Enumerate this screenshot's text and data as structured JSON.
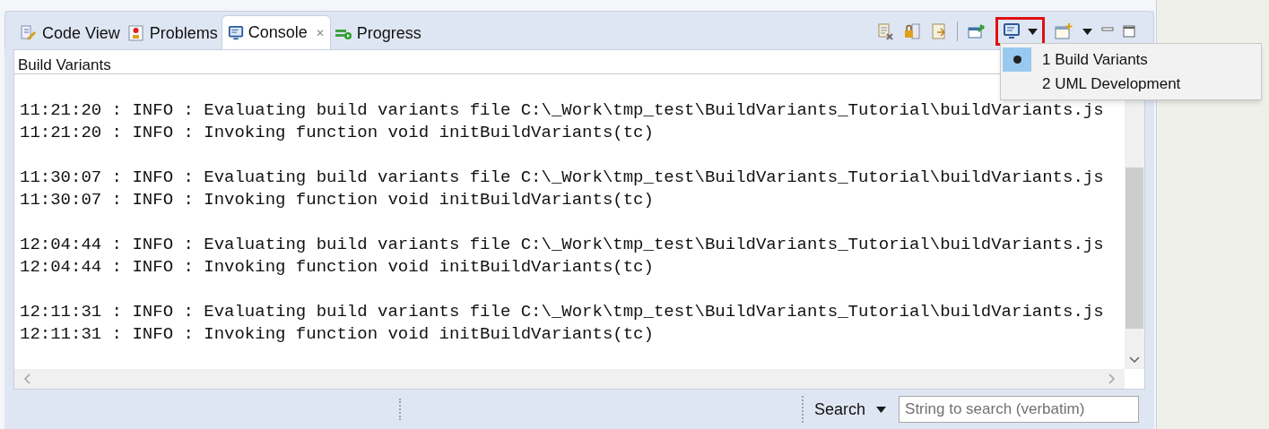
{
  "tabs": [
    {
      "label": "Code View",
      "selected": false
    },
    {
      "label": "Problems",
      "selected": false
    },
    {
      "label": "Console",
      "selected": true
    },
    {
      "label": "Progress",
      "selected": false
    }
  ],
  "close_glyph": "✕",
  "console": {
    "title": "Build Variants",
    "groups": [
      [
        "11:21:20 : INFO : Evaluating build variants file C:\\_Work\\tmp_test\\BuildVariants_Tutorial\\buildVariants.js",
        "11:21:20 : INFO : Invoking function void initBuildVariants(tc)"
      ],
      [
        "11:30:07 : INFO : Evaluating build variants file C:\\_Work\\tmp_test\\BuildVariants_Tutorial\\buildVariants.js",
        "11:30:07 : INFO : Invoking function void initBuildVariants(tc)"
      ],
      [
        "12:04:44 : INFO : Evaluating build variants file C:\\_Work\\tmp_test\\BuildVariants_Tutorial\\buildVariants.js",
        "12:04:44 : INFO : Invoking function void initBuildVariants(tc)"
      ],
      [
        "12:11:31 : INFO : Evaluating build variants file C:\\_Work\\tmp_test\\BuildVariants_Tutorial\\buildVariants.js",
        "12:11:31 : INFO : Invoking function void initBuildVariants(tc)"
      ]
    ]
  },
  "console_menu": {
    "items": [
      {
        "label": "1 Build Variants",
        "selected": true
      },
      {
        "label": "2 UML Development",
        "selected": false
      }
    ]
  },
  "search": {
    "label": "Search",
    "placeholder": "String to search (verbatim)"
  }
}
